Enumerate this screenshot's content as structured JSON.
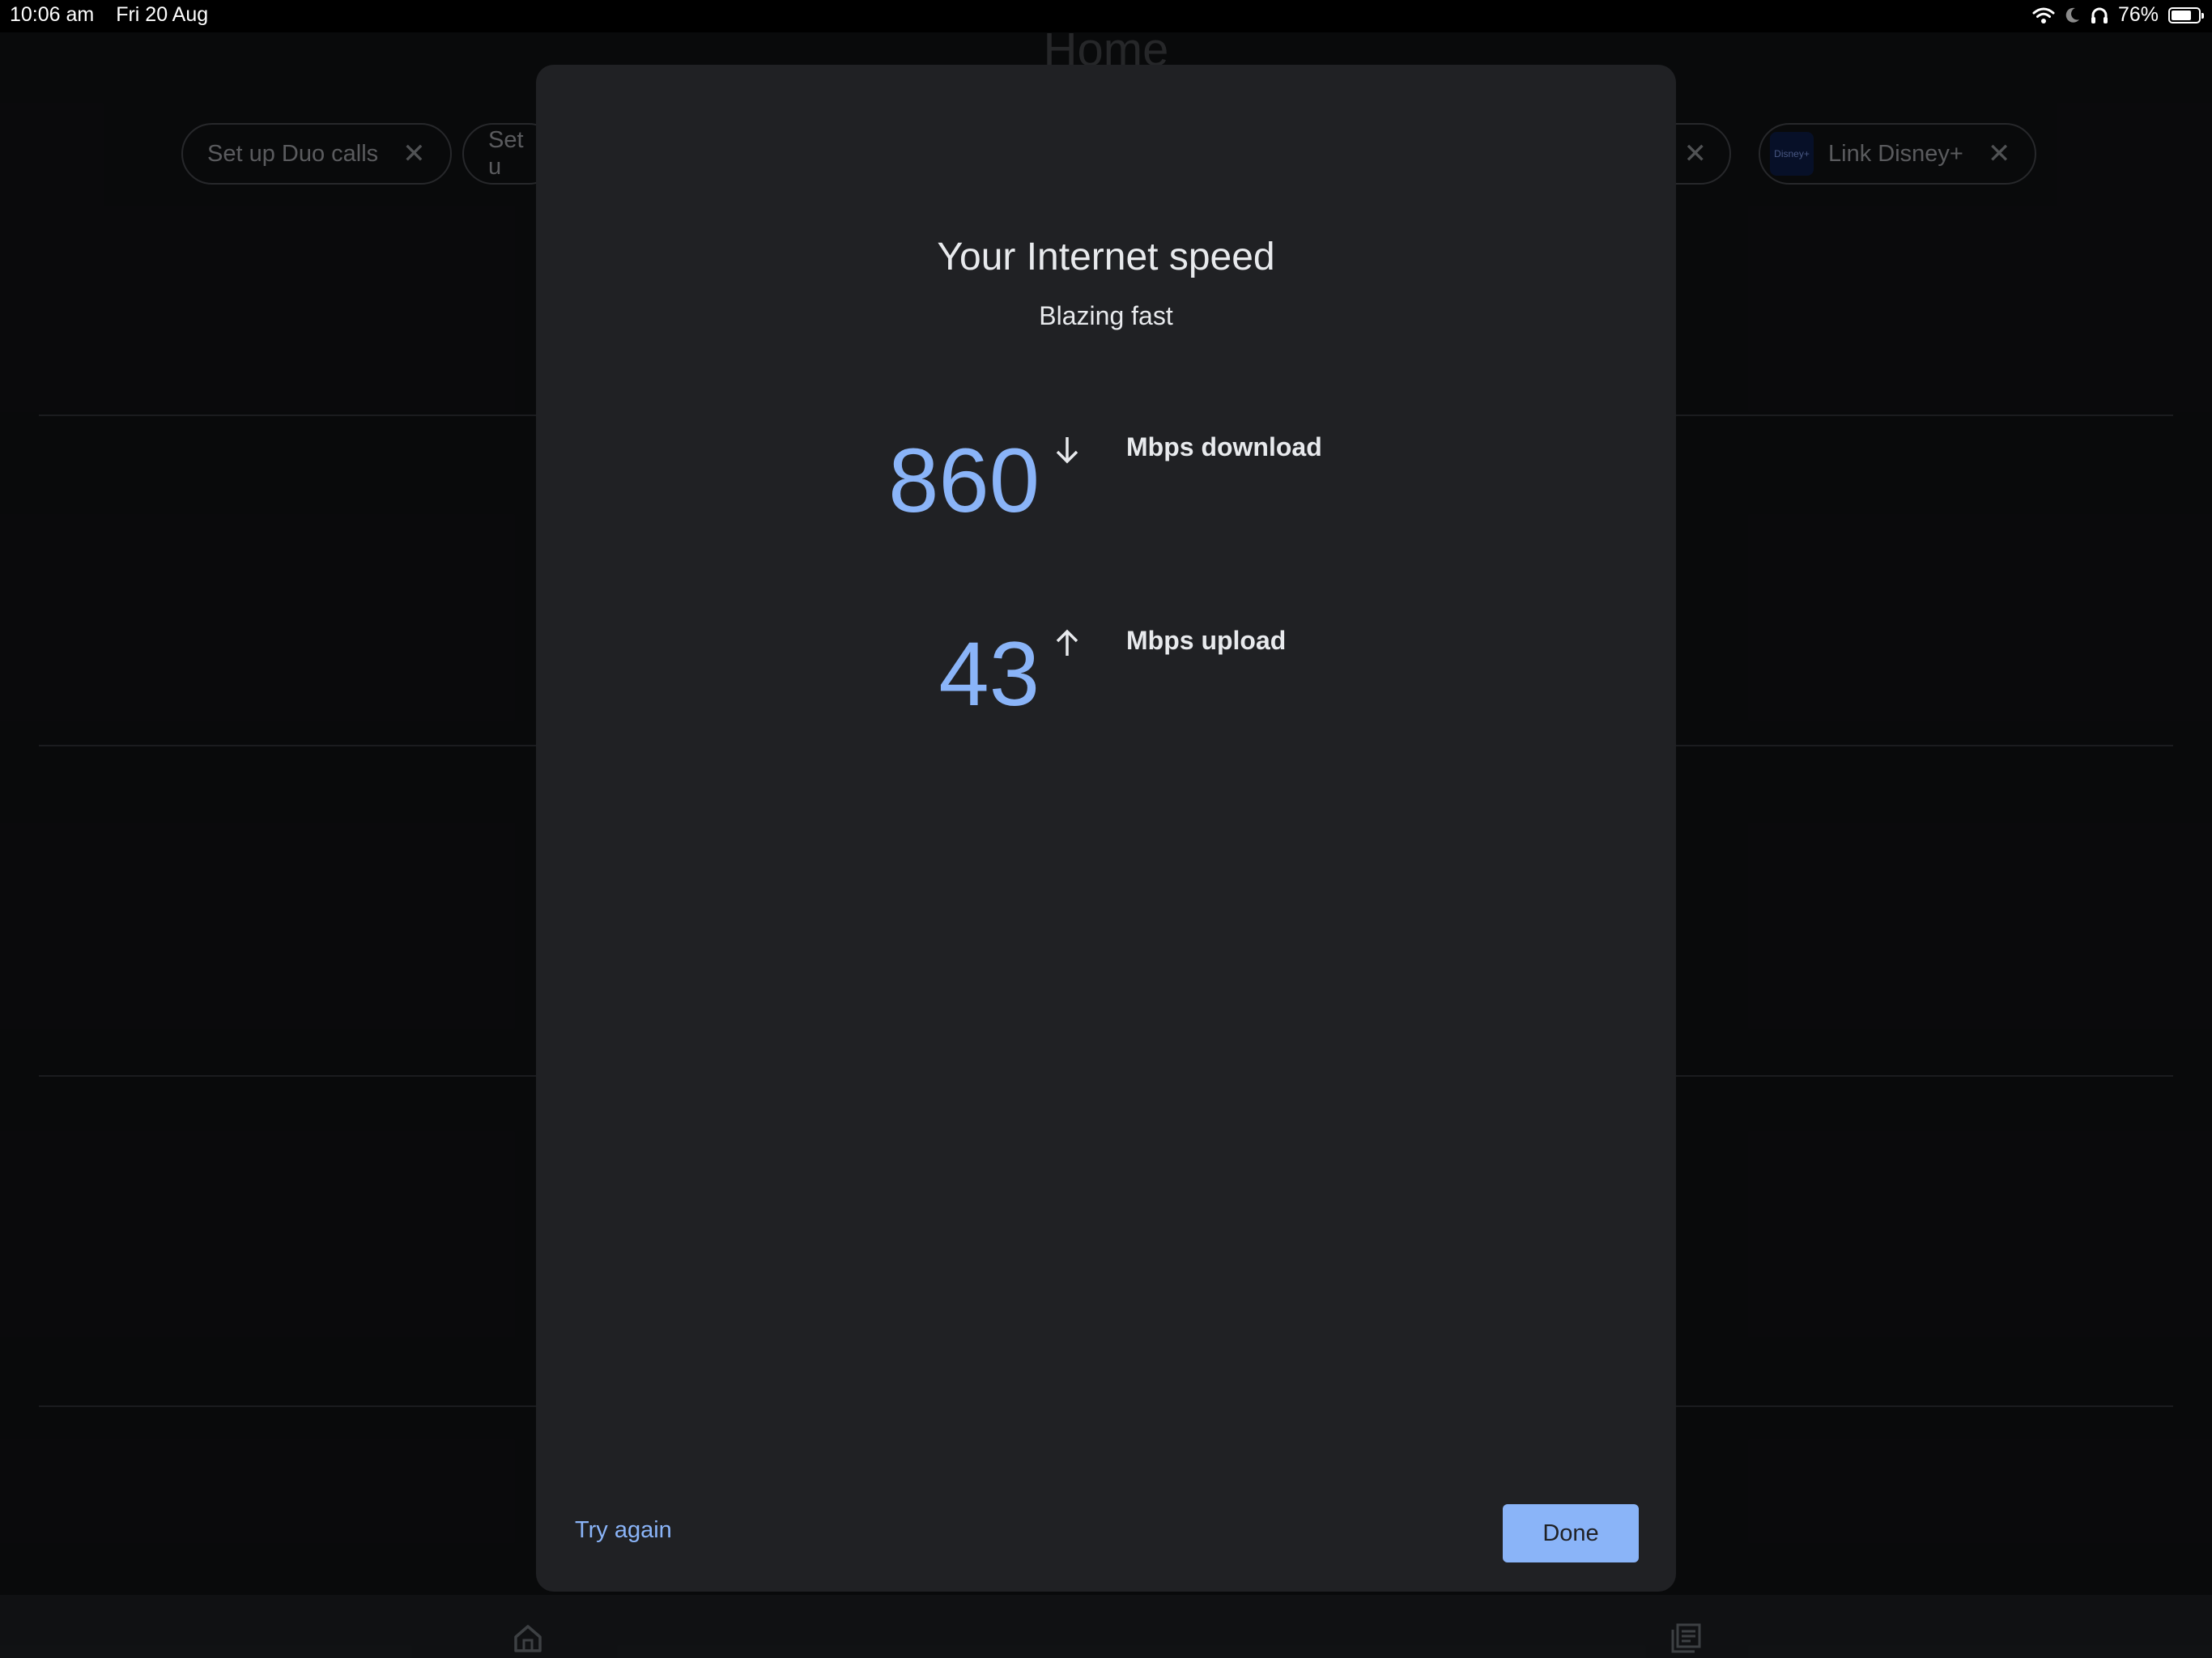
{
  "status_bar": {
    "time": "10:06 am",
    "date": "Fri 20 Aug",
    "battery": "76%",
    "battery_level": 0.76
  },
  "background": {
    "title": "Home",
    "chips": [
      {
        "label": "Set up Duo calls"
      },
      {
        "label": "Set u"
      },
      {
        "label": "Link Disney+",
        "thumb_text": "Disney+"
      }
    ]
  },
  "dialog": {
    "title": "Your Internet speed",
    "subtitle": "Blazing fast",
    "download": {
      "value": "860",
      "label": "Mbps download"
    },
    "upload": {
      "value": "43",
      "label": "Mbps upload"
    },
    "try_again_label": "Try again",
    "done_label": "Done"
  },
  "colors": {
    "accent": "#8ab4f8",
    "dialog_bg": "#202124",
    "text": "#e8eaed"
  }
}
